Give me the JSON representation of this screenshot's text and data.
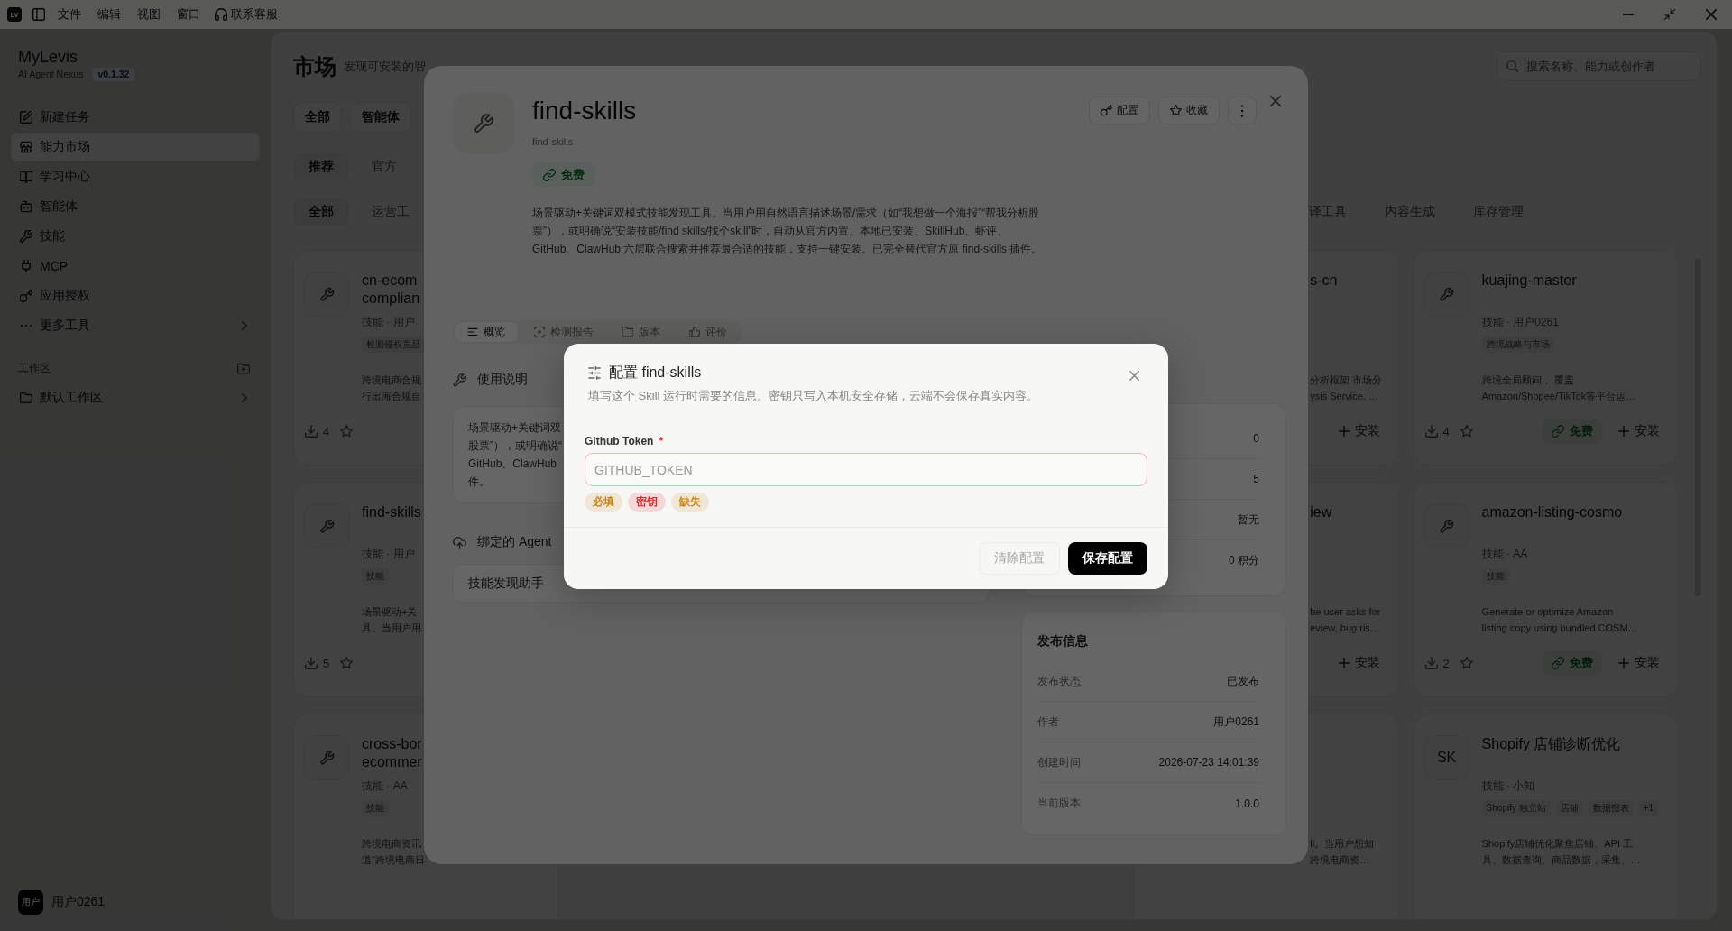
{
  "title_bar": {
    "logo": "LV",
    "menu": [
      "文件",
      "编辑",
      "视图",
      "窗口"
    ],
    "support": "联系客服"
  },
  "sidebar": {
    "brand": "MyLevis",
    "tagline": "AI Agent Nexus",
    "version": "v0.1.32",
    "nav": [
      {
        "label": "新建任务",
        "selected": false,
        "has_children": false
      },
      {
        "label": "能力市场",
        "selected": true,
        "has_children": false
      },
      {
        "label": "学习中心",
        "selected": false,
        "has_children": false
      },
      {
        "label": "智能体",
        "selected": false,
        "has_children": false
      },
      {
        "label": "技能",
        "selected": false,
        "has_children": false
      },
      {
        "label": "MCP",
        "selected": false,
        "has_children": false
      },
      {
        "label": "应用授权",
        "selected": false,
        "has_children": false
      },
      {
        "label": "更多工具",
        "selected": false,
        "has_children": true
      }
    ],
    "workspace_heading": "工作区",
    "workspaces": [
      {
        "label": "默认工作区",
        "selected": false,
        "has_children": true
      }
    ],
    "user": {
      "avatar": "用户",
      "name": "用户0261"
    }
  },
  "market": {
    "title": "市场",
    "subtitle": "发现可安装的智",
    "search": {
      "placeholder": "搜索名称、能力或创作者"
    },
    "type_filters": [
      {
        "label": "全部",
        "selected": false
      },
      {
        "label": "智能体",
        "selected": false
      }
    ],
    "source_filters": [
      {
        "label": "推荐",
        "selected": true
      },
      {
        "label": "官方",
        "selected": false
      }
    ],
    "category_filters": [
      {
        "label": "全部",
        "selected": true
      },
      {
        "label": "运营工",
        "selected": false
      },
      {
        "label": "译工具",
        "selected": false
      },
      {
        "label": "内容生成",
        "selected": false
      },
      {
        "label": "库存管理",
        "selected": false
      }
    ],
    "cards": [
      {
        "kind": "icon",
        "title_lines": [
          "cn-ecom",
          "complian"
        ],
        "meta": "技能 · 用户",
        "tags": [
          "检测侵权竞品"
        ],
        "description_lines": [
          "跨境电商合规",
          "行出海合规自"
        ],
        "downloads": "4"
      },
      {
        "title_lines": [
          "s-cn"
        ],
        "description_lines": [
          "分析框架 市场分",
          "ysis Service. …"
        ],
        "install": "安装"
      },
      {
        "kind": "icon",
        "title_lines": [
          "kuajing-master"
        ],
        "meta": "技能 · 用户0261",
        "tags": [
          "跨境战略与市场"
        ],
        "description_lines": [
          "跨境全局顾问， 覆盖",
          "Amazon/Shopee/TikTok等平台运…"
        ],
        "downloads": "4",
        "price": "免费",
        "install": "安装"
      },
      {
        "kind": "icon",
        "title_lines": [
          "find-skills"
        ],
        "meta": "技能 · 用户",
        "tags": [
          "技能"
        ],
        "description_lines": [
          "场景驱动+关",
          "具。当用户用"
        ],
        "downloads": "5"
      },
      {
        "title_lines": [
          "iew"
        ],
        "description_lines": [
          "he user asks for",
          "eview, bug ris…"
        ],
        "install": "安装"
      },
      {
        "kind": "icon",
        "title_lines": [
          "amazon-listing-cosmo"
        ],
        "meta": "技能 · AA",
        "tags": [
          "技能"
        ],
        "description_lines": [
          "Generate or optimize Amazon",
          "listing copy using bundled COSM…"
        ],
        "downloads": "2",
        "price": "免费",
        "install": "安装"
      },
      {
        "kind": "icon",
        "title_lines": [
          "cross-bor",
          "ecommer"
        ],
        "meta": "技能 · AA",
        "tags": [
          "技能"
        ],
        "description_lines": [
          "跨境电商资讯",
          "道“跨境电商日"
        ]
      },
      {
        "description_lines": [
          "ll。当用户想知",
          "跨境电商资…"
        ]
      },
      {
        "kind": "monogram",
        "monogram": "SK",
        "title_lines": [
          "Shopify 店铺诊断优化"
        ],
        "meta": "技能 · 小知",
        "tags": [
          "Shopify 独立站",
          "店铺",
          "数据报表",
          "+1"
        ],
        "description_lines": [
          "Shopify店铺优化聚焦店铺、API 工",
          "具、数据查询、商品数据，采集、…"
        ]
      }
    ]
  },
  "detail": {
    "title": "find-skills",
    "slug": "find-skills",
    "price": "免费",
    "actions": [
      "配置",
      "收藏"
    ],
    "description": "场景驱动+关键词双模式技能发现工具。当用户用自然语言描述场景/需求（如“我想做一个海报”“帮我分析股票”），或明确说“安装技能/find skills/找个skill”时，自动从官方内置、本地已安装、SkillHub、虾评、GitHub、ClawHub 六层联合搜索并推荐最合适的技能，支持一键安装。已完全替代官方原 find-skills 插件。",
    "tabs": [
      {
        "label": "概览",
        "selected": true
      },
      {
        "label": "检测报告",
        "selected": false
      },
      {
        "label": "版本",
        "selected": false
      },
      {
        "label": "评价",
        "selected": false
      }
    ],
    "usage": {
      "title": "使用说明",
      "lines": [
        "场景驱动+关键词双",
        "股票”），或明确说“",
        "GitHub、ClawHub",
        "件。"
      ]
    },
    "agent": {
      "title": "绑定的 Agent",
      "name": "技能发现助手"
    },
    "summary_values": [
      "0",
      "5",
      "暂无",
      "0 积分"
    ],
    "publish_info": {
      "title": "发布信息",
      "rows": [
        {
          "label": "发布状态",
          "value": "已发布"
        },
        {
          "label": "作者",
          "value": "用户0261"
        },
        {
          "label": "创建时间",
          "value": "2026-07-23 14:01:39"
        },
        {
          "label": "当前版本",
          "value": "1.0.0"
        }
      ]
    }
  },
  "config_dialog": {
    "title": "配置 find-skills",
    "description": "填写这个 Skill 运行时需要的信息。密钥只写入本机安全存储，云端不会保存真实内容。",
    "field": {
      "label": "Github Token",
      "required_mark": "*",
      "placeholder": "GITHUB_TOKEN",
      "invalid": true,
      "tags": [
        {
          "label": "必填",
          "color": "#c98212"
        },
        {
          "label": "密钥",
          "color": "#e0262b"
        },
        {
          "label": "缺失",
          "color": "#c98212"
        }
      ]
    },
    "buttons": [
      {
        "label": "清除配置",
        "kind": "secondary",
        "disabled": true
      },
      {
        "label": "保存配置",
        "kind": "primary",
        "disabled": false
      }
    ]
  }
}
